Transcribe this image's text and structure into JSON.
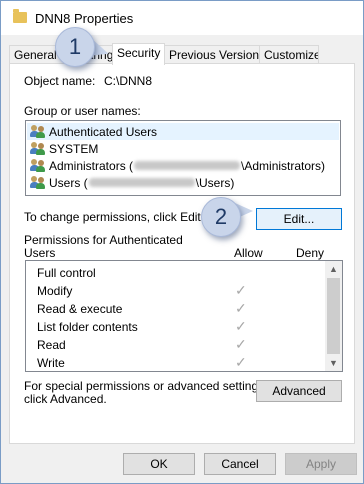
{
  "window": {
    "title": "DNN8 Properties"
  },
  "tabs": [
    {
      "label": "General"
    },
    {
      "label": "Sharing"
    },
    {
      "label": "Security"
    },
    {
      "label": "Previous Versions"
    },
    {
      "label": "Customize"
    }
  ],
  "security": {
    "object_name_label": "Object name:",
    "object_name_value": "C:\\DNN8",
    "group_label": "Group or user names:",
    "users": [
      {
        "name": "Authenticated Users",
        "suffix": ""
      },
      {
        "name": "SYSTEM",
        "suffix": ""
      },
      {
        "name": "Administrators (",
        "suffix": "\\Administrators)"
      },
      {
        "name": "Users (",
        "suffix": "\\Users)"
      }
    ],
    "change_text": "To change permissions, click Edit.",
    "edit_label": "Edit...",
    "permissions_for_line1": "Permissions for Authenticated",
    "permissions_for_line2": "Users",
    "allow_header": "Allow",
    "deny_header": "Deny",
    "permissions": [
      {
        "name": "Full control",
        "allow": ""
      },
      {
        "name": "Modify",
        "allow": "✓"
      },
      {
        "name": "Read & execute",
        "allow": "✓"
      },
      {
        "name": "List folder contents",
        "allow": "✓"
      },
      {
        "name": "Read",
        "allow": "✓"
      },
      {
        "name": "Write",
        "allow": "✓"
      }
    ],
    "special_line1": "For special permissions or advanced settings,",
    "special_line2": "click Advanced.",
    "advanced_label": "Advanced"
  },
  "buttons": {
    "ok": "OK",
    "cancel": "Cancel",
    "apply": "Apply"
  },
  "callouts": {
    "one": "1",
    "two": "2"
  }
}
